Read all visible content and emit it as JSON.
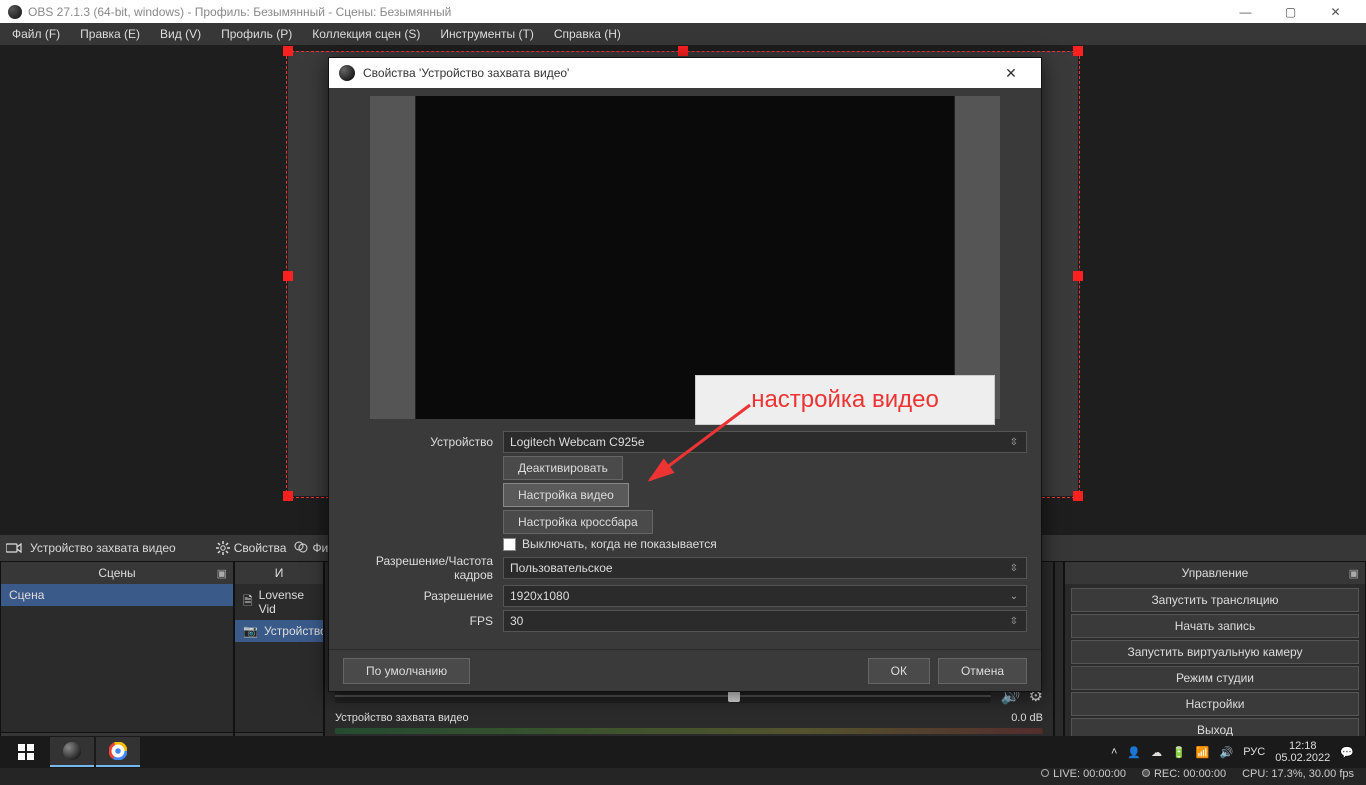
{
  "titlebar": {
    "title": "OBS 27.1.3 (64-bit, windows) - Профиль: Безымянный - Сцены: Безымянный"
  },
  "menubar": {
    "items": [
      {
        "label": "Файл (F)"
      },
      {
        "label": "Правка (E)"
      },
      {
        "label": "Вид (V)"
      },
      {
        "label": "Профиль (P)"
      },
      {
        "label": "Коллекция сцен (S)"
      },
      {
        "label": "Инструменты (T)"
      },
      {
        "label": "Справка (H)"
      }
    ]
  },
  "sources_toolbar": {
    "selected": "Устройство захвата видео",
    "props": "Свойства",
    "filters": "Фи"
  },
  "annotation": "настройка видео",
  "docks": {
    "scenes": {
      "title": "Сцены",
      "items": [
        "Сцена"
      ]
    },
    "sources": {
      "title": "И",
      "items": [
        {
          "icon": "doc",
          "label": "Lovense Vid"
        },
        {
          "icon": "cam",
          "label": "Устройство"
        }
      ]
    },
    "mixer": {
      "rows": [
        {
          "name": "Устройство захвата видео",
          "db": "0.0 dB"
        }
      ]
    },
    "controls": {
      "title": "Управление",
      "buttons": [
        "Запустить трансляцию",
        "Начать запись",
        "Запустить виртуальную камеру",
        "Режим студии",
        "Настройки",
        "Выход"
      ]
    }
  },
  "dialog": {
    "title": "Свойства 'Устройство захвата видео'",
    "labels": {
      "device": "Устройство",
      "res_fps": "Разрешение/Частота кадров",
      "res": "Разрешение",
      "fps": "FPS"
    },
    "values": {
      "device": "Logitech Webcam C925e",
      "res_type": "Пользовательское",
      "res": "1920x1080",
      "fps": "30"
    },
    "buttons": {
      "deactivate": "Деактивировать",
      "video_config": "Настройка видео",
      "crossbar": "Настройка кроссбара",
      "deactivate_hidden": "Выключать, когда не показывается",
      "defaults": "По умолчанию",
      "ok": "ОК",
      "cancel": "Отмена"
    }
  },
  "statusbar": {
    "live": "LIVE: 00:00:00",
    "rec": "REC: 00:00:00",
    "cpu": "CPU: 17.3%, 30.00 fps"
  },
  "taskbar": {
    "lang": "РУС",
    "time": "12:18",
    "date": "05.02.2022"
  }
}
